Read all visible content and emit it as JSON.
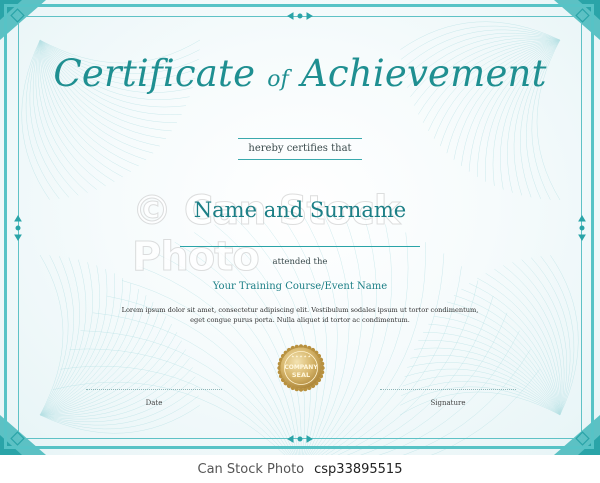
{
  "certificate": {
    "title_part1": "Certificate",
    "title_of": "of",
    "title_part2": "Achievement",
    "subtitle": "hereby certifies that",
    "recipient": "Name and Surname",
    "attended": "attended the",
    "course": "Your Training Course/Event Name",
    "body_line1": "Lorem ipsum dolor sit amet, consectetur adipiscing elit. Vestibulum sodales ipsum ut tortor condimentum,",
    "body_line2": "eget congue purus porta. Nulla aliquet id tortor ac condimentum.",
    "seal_top": "COMPANY",
    "seal_bottom": "SEAL",
    "date_label": "Date",
    "signature_label": "Signature"
  },
  "watermark": {
    "text": "© Can Stock Photo"
  },
  "footer": {
    "brand": "Can Stock Photo",
    "image_id": "csp33895515"
  },
  "colors": {
    "accent": "#1f8f91",
    "frame": "#57c3c6",
    "seal_gold": "#c9a85a"
  }
}
